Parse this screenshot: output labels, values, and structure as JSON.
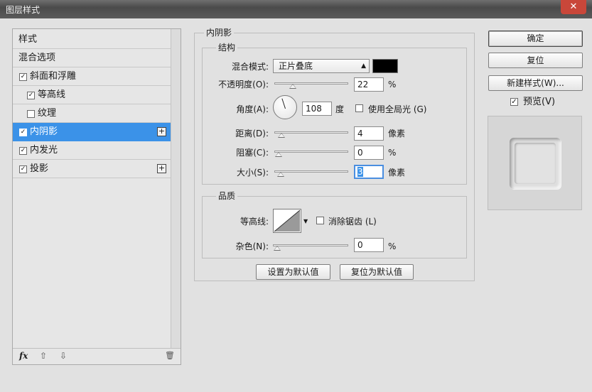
{
  "window": {
    "title": "图层样式",
    "close": "✕"
  },
  "style_list": {
    "items": [
      {
        "label": "样式",
        "checkbox": false,
        "checked": false,
        "indent": false,
        "plus": false,
        "selected": false
      },
      {
        "label": "混合选项",
        "checkbox": false,
        "checked": false,
        "indent": false,
        "plus": false,
        "selected": false
      },
      {
        "label": "斜面和浮雕",
        "checkbox": true,
        "checked": true,
        "indent": false,
        "plus": false,
        "selected": false
      },
      {
        "label": "等高线",
        "checkbox": true,
        "checked": true,
        "indent": true,
        "plus": false,
        "selected": false
      },
      {
        "label": "纹理",
        "checkbox": true,
        "checked": false,
        "indent": true,
        "plus": false,
        "selected": false
      },
      {
        "label": "内阴影",
        "checkbox": true,
        "checked": true,
        "indent": false,
        "plus": true,
        "selected": true
      },
      {
        "label": "内发光",
        "checkbox": true,
        "checked": true,
        "indent": false,
        "plus": false,
        "selected": false
      },
      {
        "label": "投影",
        "checkbox": true,
        "checked": true,
        "indent": false,
        "plus": true,
        "selected": false
      }
    ],
    "bottom": {
      "fx": "fx",
      "up": "⇧",
      "down": "⇩",
      "trash": "🗑"
    }
  },
  "panel": {
    "title": "内阴影",
    "structure": {
      "title": "结构",
      "blend_mode_label": "混合模式:",
      "blend_mode_value": "正片叠底",
      "blend_color": "#000000",
      "opacity_label": "不透明度(O):",
      "opacity_value": "22",
      "opacity_unit": "%",
      "opacity_level": 0.22,
      "angle_label": "角度(A):",
      "angle_value": "108",
      "angle_unit": "度",
      "global_light_label": "使用全局光 (G)",
      "global_light_checked": false,
      "distance_label": "距离(D):",
      "distance_value": "4",
      "distance_unit": "像素",
      "distance_level": 0.04,
      "choke_label": "阻塞(C):",
      "choke_value": "0",
      "choke_unit": "%",
      "choke_level": 0,
      "size_label": "大小(S):",
      "size_value": "3",
      "size_unit": "像素",
      "size_level": 0.03
    },
    "quality": {
      "title": "品质",
      "contour_label": "等高线:",
      "antialias_label": "消除锯齿 (L)",
      "antialias_checked": false,
      "noise_label": "杂色(N):",
      "noise_value": "0",
      "noise_unit": "%",
      "noise_level": 0
    },
    "make_default": "设置为默认值",
    "reset_default": "复位为默认值"
  },
  "actions": {
    "ok": "确定",
    "reset": "复位",
    "new_style": "新建样式(W)...",
    "preview_label": "预览(V)",
    "preview_checked": true
  }
}
